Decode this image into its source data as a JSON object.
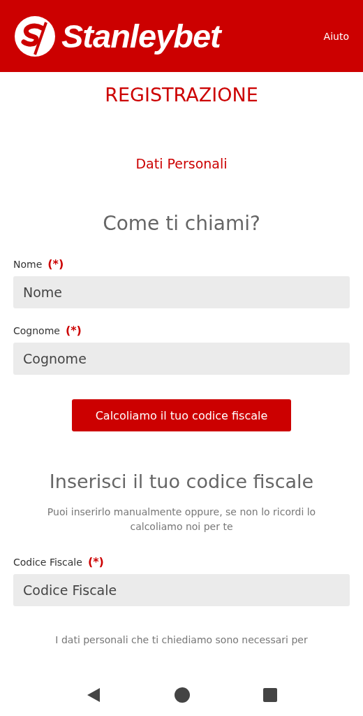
{
  "header": {
    "brand": "Stanleybet",
    "help_link": "Aiuto"
  },
  "page_title": "REGISTRAZIONE",
  "step_title": "Dati Personali",
  "section_1": {
    "heading": "Come ti chiami?",
    "fields": [
      {
        "label": "Nome",
        "required_mark": "(*)",
        "placeholder": "Nome"
      },
      {
        "label": "Cognome",
        "required_mark": "(*)",
        "placeholder": "Cognome"
      }
    ],
    "button": "Calcoliamo il tuo codice fiscale"
  },
  "section_2": {
    "heading": "Inserisci il tuo codice fiscale",
    "description": "Puoi inserirlo manualmente oppure, se non lo ricordi lo calcoliamo noi per te",
    "fields": [
      {
        "label": "Codice Fiscale",
        "required_mark": "(*)",
        "placeholder": "Codice Fiscale"
      }
    ]
  },
  "footer_text": "I dati personali che ti chiediamo sono necessari per"
}
